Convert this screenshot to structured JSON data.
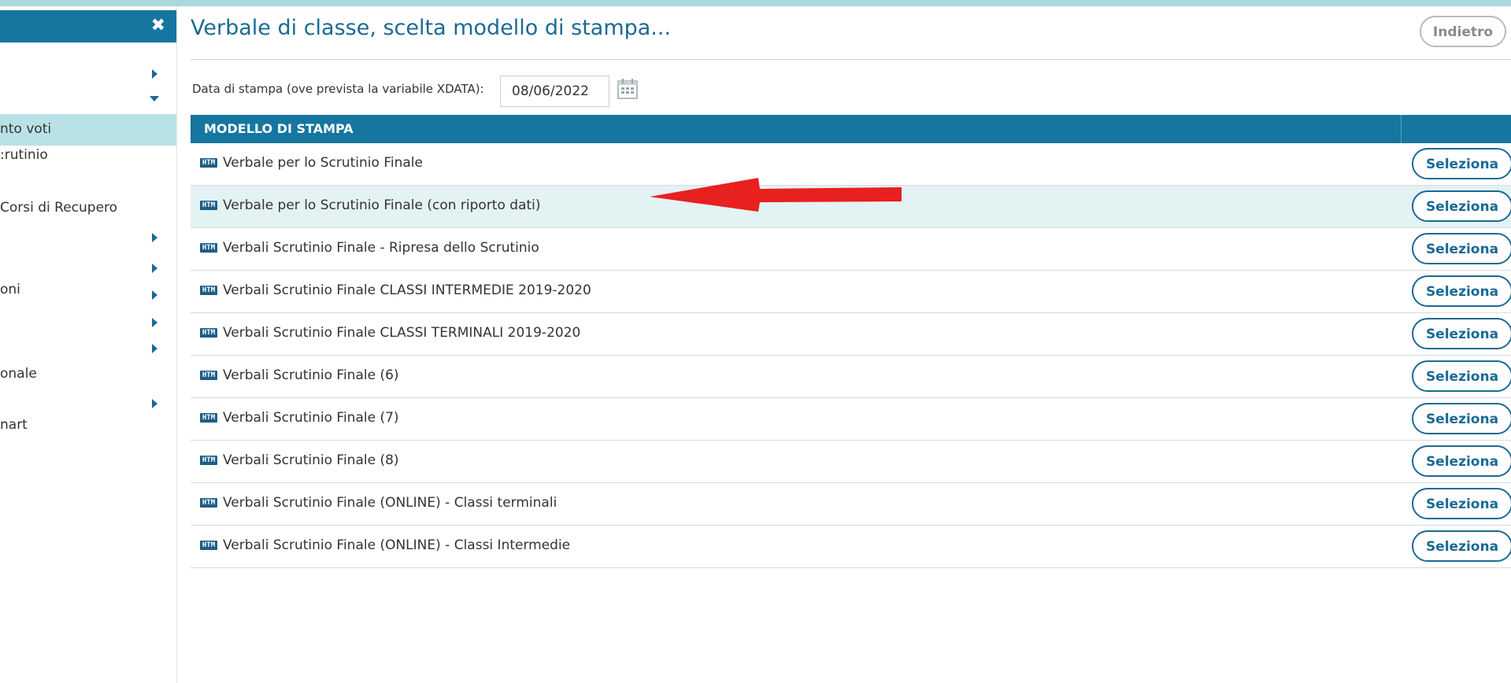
{
  "sidebar": {
    "close_icon": "close-icon",
    "items": [
      {
        "label": "",
        "arrow": "right"
      },
      {
        "label": "",
        "arrow": "down"
      },
      {
        "label": "nto voti",
        "arrow": ""
      },
      {
        "label": ":rutinio",
        "arrow": ""
      },
      {
        "label": " Corsi di Recupero",
        "arrow": ""
      },
      {
        "label": "",
        "arrow": "right"
      },
      {
        "label": "",
        "arrow": "right"
      },
      {
        "label": "oni",
        "arrow": "right"
      },
      {
        "label": "",
        "arrow": "right"
      },
      {
        "label": "",
        "arrow": "right"
      },
      {
        "label": "onale",
        "arrow": ""
      },
      {
        "label": "",
        "arrow": "right"
      },
      {
        "label": "nart",
        "arrow": ""
      }
    ]
  },
  "header": {
    "title": "Verbale di classe, scelta modello di stampa...",
    "back_label": "Indietro"
  },
  "date": {
    "label": "Data di stampa (ove prevista la variabile XDATA):",
    "value": "08/06/2022",
    "icon": "calendar-icon"
  },
  "table": {
    "column_header": "MODELLO DI STAMPA",
    "badge": "HTM",
    "select_label": "Seleziona",
    "rows": [
      "Verbale per lo Scrutinio Finale",
      "Verbale per lo Scrutinio Finale (con riporto dati)",
      "Verbali Scrutinio Finale - Ripresa dello Scrutinio",
      "Verbali Scrutinio Finale CLASSI INTERMEDIE 2019-2020",
      "Verbali Scrutinio Finale CLASSI TERMINALI 2019-2020",
      "Verbali Scrutinio Finale (6)",
      "Verbali Scrutinio Finale (7)",
      "Verbali Scrutinio Finale (8)",
      "Verbali Scrutinio Finale (ONLINE) - Classi terminali",
      "Verbali Scrutinio Finale (ONLINE) - Classi Intermedie"
    ]
  },
  "colors": {
    "header_blue": "#1576a0",
    "link_blue": "#1a6a94",
    "highlight_row": "#e3f2f3",
    "active_sidebar": "#b9e2e6",
    "annotation_arrow": "#e8201f"
  }
}
